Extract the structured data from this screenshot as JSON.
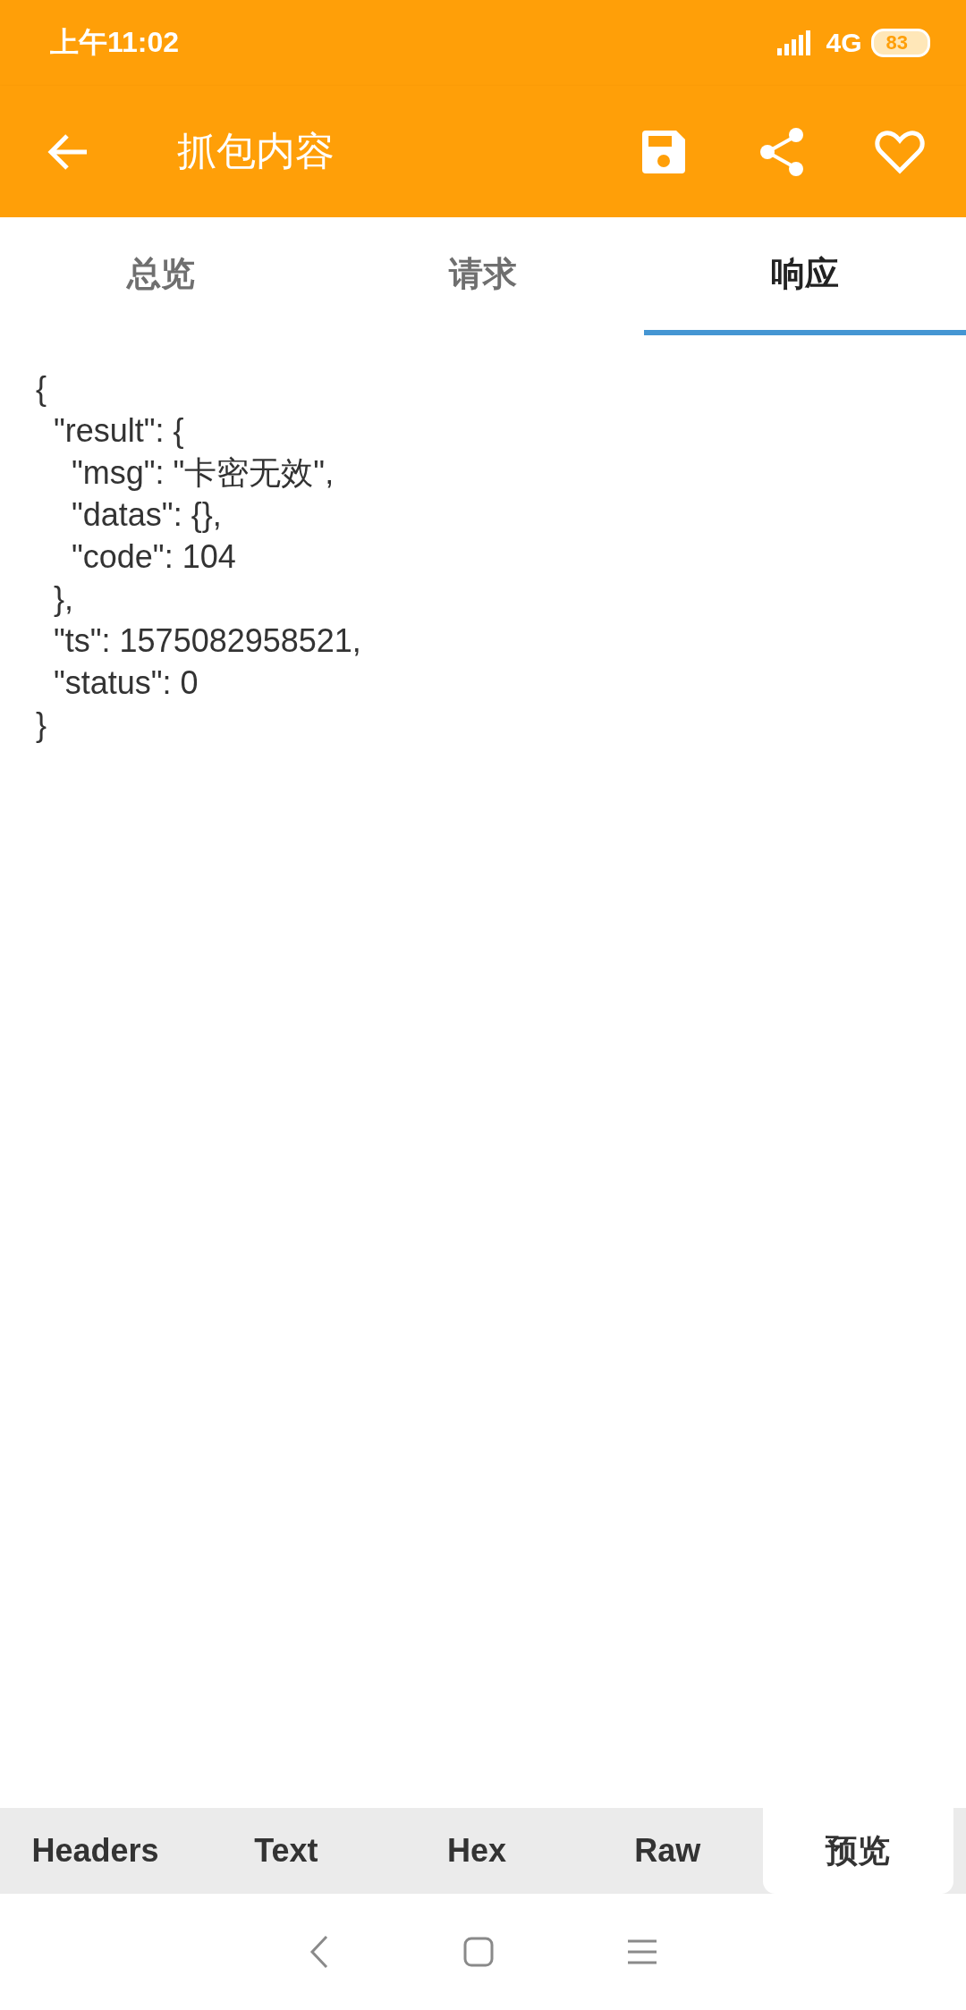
{
  "status_bar": {
    "time": "上午11:02",
    "network": "4G",
    "battery": "83"
  },
  "toolbar": {
    "title": "抓包内容"
  },
  "tabs": [
    {
      "label": "总览",
      "selected": false
    },
    {
      "label": "请求",
      "selected": false
    },
    {
      "label": "响应",
      "selected": true
    }
  ],
  "response_body": "{\n  \"result\": {\n    \"msg\": \"卡密无效\",\n    \"datas\": {},\n    \"code\": 104\n  },\n  \"ts\": 1575082958521,\n  \"status\": 0\n}",
  "view_tabs": [
    {
      "label": "Headers",
      "selected": false
    },
    {
      "label": "Text",
      "selected": false
    },
    {
      "label": "Hex",
      "selected": false
    },
    {
      "label": "Raw",
      "selected": false
    },
    {
      "label": "预览",
      "selected": true
    }
  ]
}
